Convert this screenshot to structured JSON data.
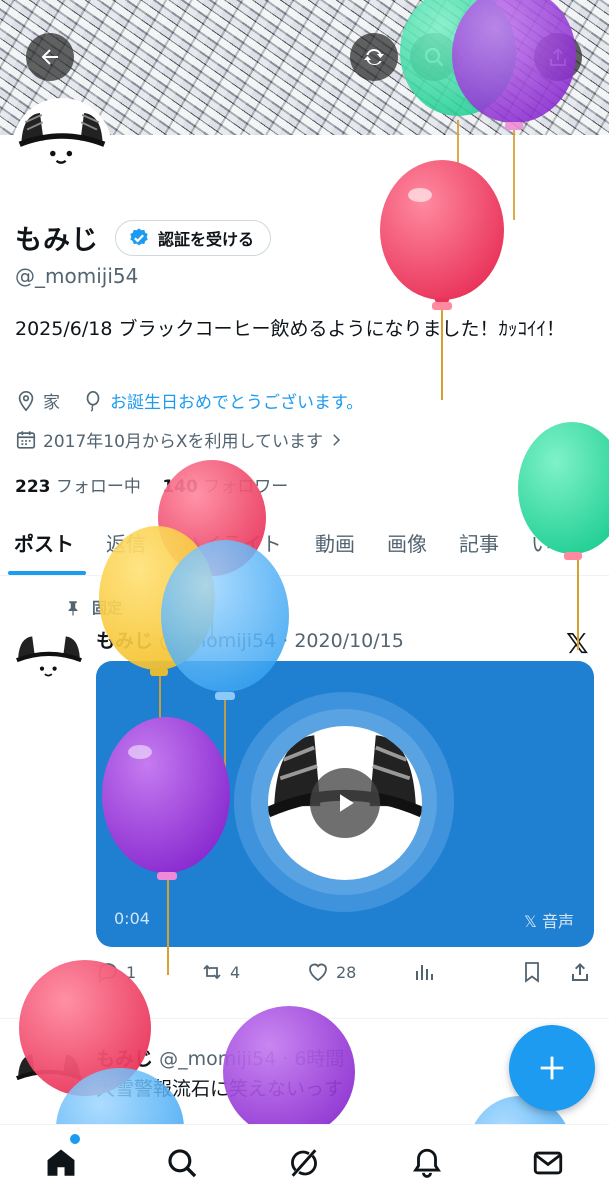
{
  "header": {
    "back_icon": "arrow-left-icon",
    "refresh_icon": "refresh-icon",
    "search_icon": "search-icon",
    "share_icon": "share-icon"
  },
  "profile": {
    "name": "もみじ",
    "verify_label": "認証を受ける",
    "handle": "@_momiji54",
    "bio": "2025/6/18 ブラックコーヒー飲めるようになりました！ｶｯｺｲｲ！",
    "location": "家",
    "birthday_text": "お誕生日おめでとうございます。",
    "joined": "2017年10月からXを利用しています",
    "following_count": "223",
    "following_label": "フォロー中",
    "followers_count": "140",
    "followers_label": "フォロワー"
  },
  "tabs": [
    "ポスト",
    "返信",
    "ハイライト",
    "動画",
    "画像",
    "記事",
    "いいね"
  ],
  "pinned_post": {
    "pinned_label": "固定",
    "name": "もみじ",
    "handle_time": "@_momiji54 · 2020/10/15",
    "media_time": "0:04",
    "media_label": "𝕏 音声",
    "replies": "1",
    "reposts": "4",
    "likes": "28"
  },
  "second_post": {
    "name": "もみじ",
    "handle_time": "@_momiji54 · 6時間",
    "text": "大雪警報流石に笑えないっす"
  },
  "bottom_nav": [
    "home-icon",
    "search-icon",
    "grok-icon",
    "notifications-icon",
    "messages-icon"
  ],
  "colors": {
    "accent": "#1d9bf0",
    "media_bg": "#1f7fd1"
  }
}
